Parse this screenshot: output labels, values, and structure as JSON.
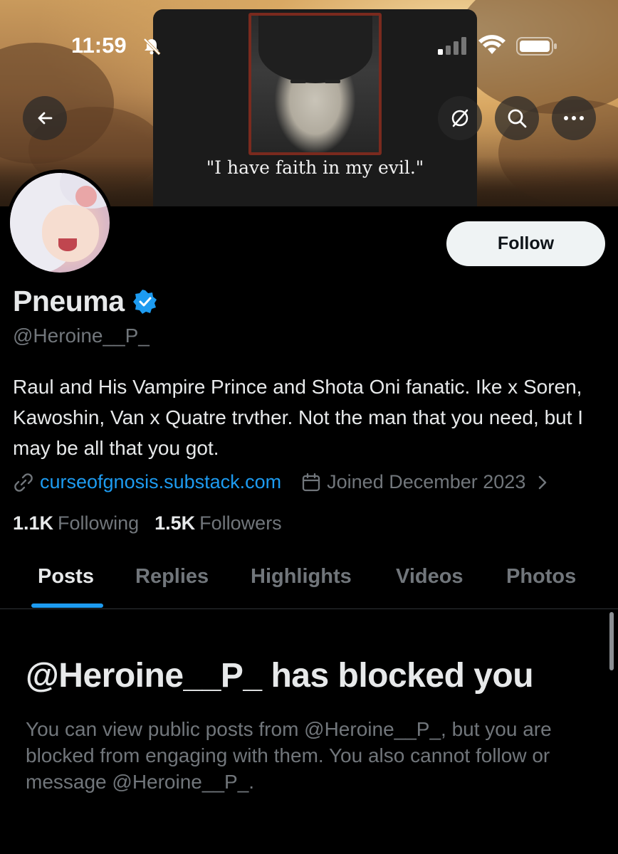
{
  "status_bar": {
    "time": "11:59",
    "icons": [
      "bell-slash-icon",
      "signal-icon",
      "wifi-icon",
      "battery-icon"
    ]
  },
  "banner": {
    "caption": "\"I have faith in my evil.\""
  },
  "header_buttons": {
    "back": "arrow-left-icon",
    "translate": "translate-off-icon",
    "search": "search-icon",
    "more": "more-icon"
  },
  "profile": {
    "display_name": "Pneuma",
    "handle": "@Heroine__P_",
    "verified": true,
    "bio": "Raul and His Vampire Prince and Shota Oni fanatic. Ike x Soren, Kawoshin, Van x Quatre trvther. Not the man that you need, but I may be all that you got.",
    "website": "curseofgnosis.substack.com",
    "joined": "Joined December 2023",
    "following_count": "1.1K",
    "following_label": "Following",
    "followers_count": "1.5K",
    "followers_label": "Followers",
    "follow_label": "Follow"
  },
  "tabs": [
    {
      "label": "Posts",
      "active": true
    },
    {
      "label": "Replies",
      "active": false
    },
    {
      "label": "Highlights",
      "active": false
    },
    {
      "label": "Videos",
      "active": false
    },
    {
      "label": "Photos",
      "active": false
    }
  ],
  "blocked": {
    "title": "@Heroine__P_ has blocked you",
    "body": "You can view public posts from @Heroine__P_, but you are blocked from engaging with them. You also cannot follow or message @Heroine__P_."
  },
  "colors": {
    "accent": "#1d9bf0",
    "background": "#000000",
    "text": "#e7e9ea",
    "muted": "#71767b"
  }
}
